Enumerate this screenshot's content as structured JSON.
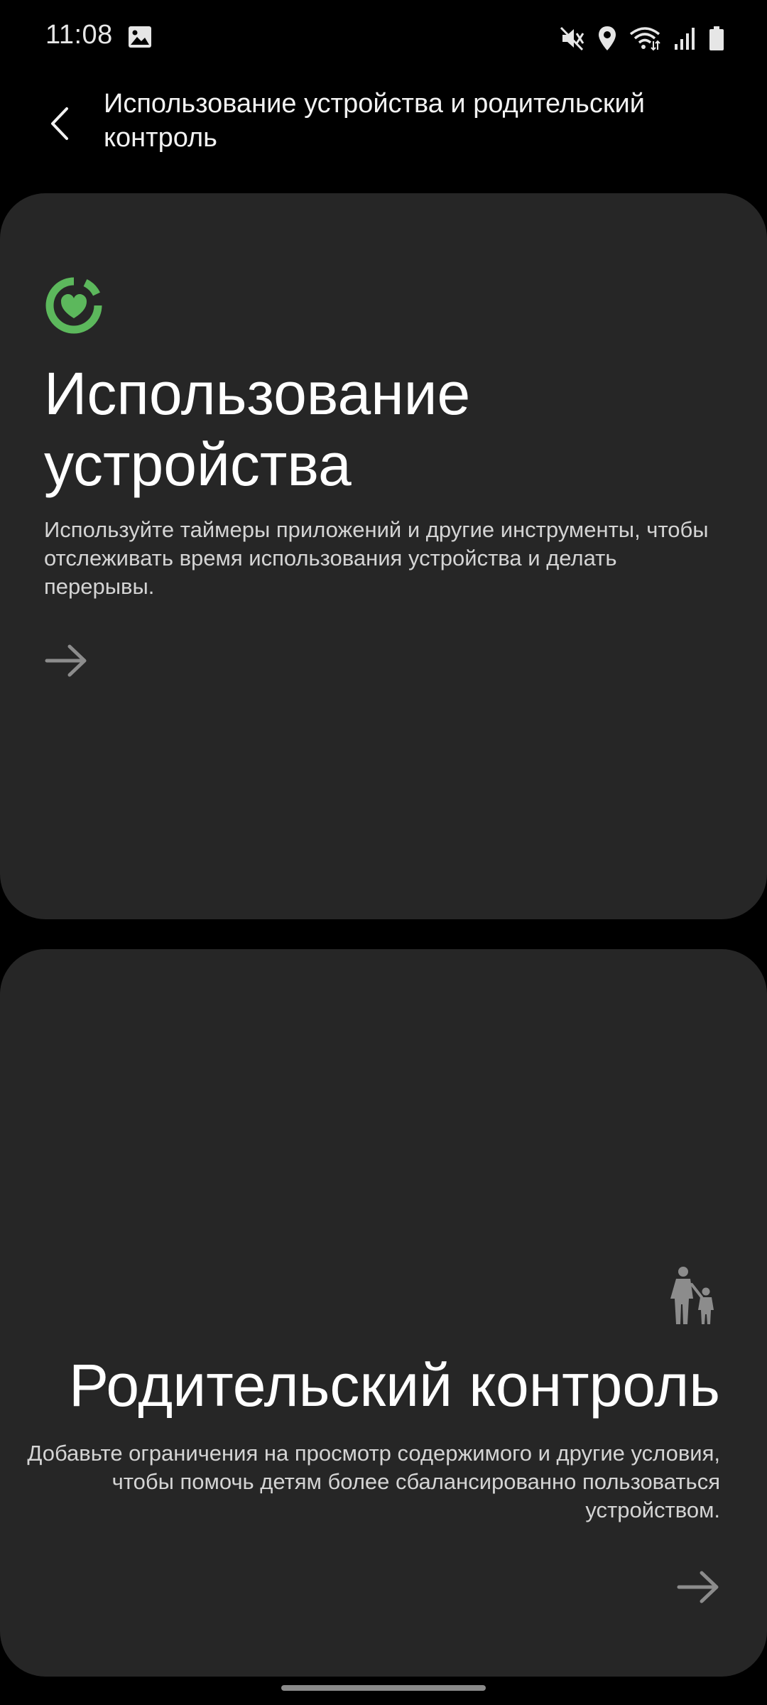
{
  "status_bar": {
    "time": "11:08",
    "icons": [
      "gallery-icon",
      "mute-icon",
      "location-icon",
      "wifi-icon",
      "signal-icon",
      "battery-icon"
    ]
  },
  "header": {
    "back_icon": "chevron-left-icon",
    "title": "Использование устройства и родительский контроль"
  },
  "cards": {
    "usage": {
      "icon": "digital-wellbeing-heart-icon",
      "title_line1": "Использование",
      "title_line2": "устройства",
      "description": "Используйте таймеры приложений и другие инструменты, чтобы отслеживать время использования устройства и делать перерывы.",
      "arrow_icon": "arrow-right-icon"
    },
    "parental": {
      "icon": "parent-child-icon",
      "title": "Родительский контроль",
      "description": "Добавьте ограничения на просмотр содержимого и другие условия, чтобы помочь детям более сбалансированно пользоваться устройством.",
      "arrow_icon": "arrow-right-icon"
    }
  },
  "colors": {
    "background": "#000000",
    "card": "#262626",
    "accent_green": "#5cb85c",
    "icon_grey": "#8c8c8c"
  }
}
